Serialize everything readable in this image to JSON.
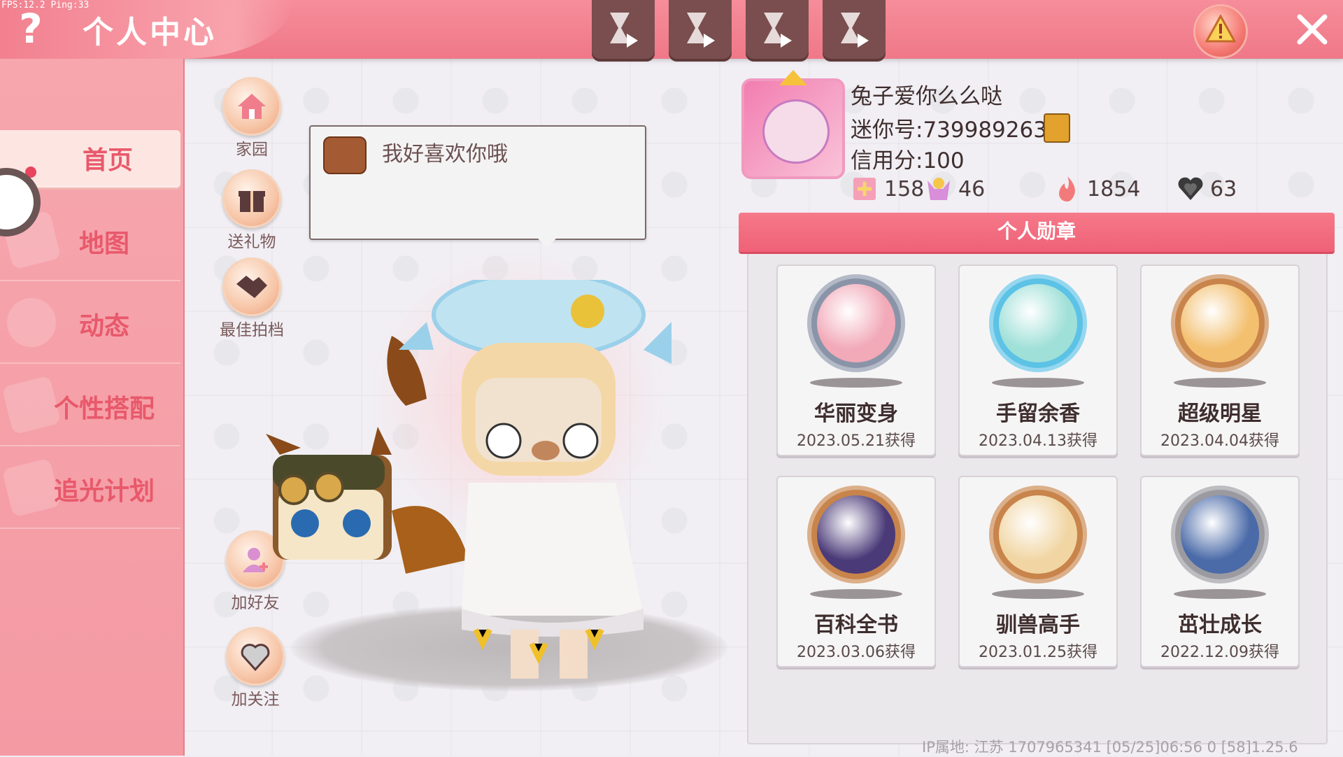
{
  "status": {
    "fps": "FPS:12.2  Ping:33"
  },
  "header": {
    "title": "个人中心",
    "help_icon": "question-mark-icon",
    "replay_buttons": [
      "hourglass-play-icon",
      "hourglass-play-icon",
      "hourglass-play-icon",
      "hourglass-play-icon"
    ],
    "warning_icon": "warning-icon",
    "close_icon": "close-icon"
  },
  "sidebar": {
    "items": [
      {
        "label": "首页",
        "active": true
      },
      {
        "label": "地图"
      },
      {
        "label": "动态"
      },
      {
        "label": "个性搭配"
      },
      {
        "label": "追光计划"
      }
    ]
  },
  "actions": {
    "home": "家园",
    "gift": "送礼物",
    "best_photo": "最佳拍档",
    "add_friend": "加好友",
    "follow": "加关注"
  },
  "bubble": {
    "text": "我好喜欢你哦"
  },
  "profile": {
    "name": "兔子爱你么么哒",
    "id": "迷你号:739989263",
    "credit": "信用分:100",
    "stats": [
      {
        "icon": "pink-badge-icon",
        "value": "158"
      },
      {
        "icon": "trophy-person-icon",
        "value": "46"
      },
      {
        "icon": "flame-icon",
        "value": "1854"
      },
      {
        "icon": "hearts-icon",
        "value": "63"
      }
    ]
  },
  "medals": {
    "title": "个人勋章",
    "items": [
      {
        "name": "华丽变身",
        "date": "2023.05.21获得",
        "ring": "#8a94a8",
        "fill": "#f2a9b8"
      },
      {
        "name": "手留余香",
        "date": "2023.04.13获得",
        "ring": "#5cc2e6",
        "fill": "#9fe0d8"
      },
      {
        "name": "超级明星",
        "date": "2023.04.04获得",
        "ring": "#c8844a",
        "fill": "#f3c070"
      },
      {
        "name": "百科全书",
        "date": "2023.03.06获得",
        "ring": "#c8844a",
        "fill": "#4a3a78"
      },
      {
        "name": "驯兽高手",
        "date": "2023.01.25获得",
        "ring": "#c8844a",
        "fill": "#f1d6a4"
      },
      {
        "name": "茁壮成长",
        "date": "2022.12.09获得",
        "ring": "#9a9aa0",
        "fill": "#4a6aa8"
      }
    ]
  },
  "footer": {
    "text": "IP属地: 江苏      1707965341   [05/25]06:56 0  [58]1.25.6"
  }
}
